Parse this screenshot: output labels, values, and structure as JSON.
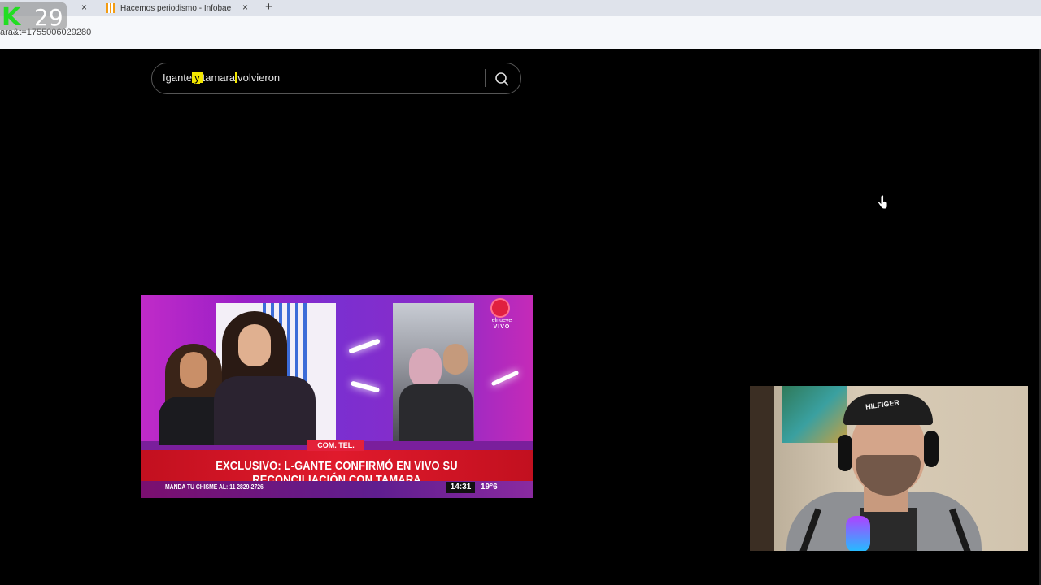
{
  "browser": {
    "tabs": [
      {
        "label": "",
        "close": "×"
      },
      {
        "label": "Hacemos periodismo - Infobae",
        "close": "×"
      }
    ],
    "new_tab": "+",
    "address": "ara&t=1755006029280",
    "overlay_badge": {
      "letter": "K",
      "number": "29",
      "color": "#22dd22"
    }
  },
  "search": {
    "query_parts": [
      "Igante",
      "y",
      "tamara",
      "volvieron"
    ],
    "icon": "search-icon"
  },
  "video": {
    "tag": "COM. TEL.",
    "headline": "EXCLUSIVO: L-GANTE CONFIRMÓ EN VIVO SU RECONCILIACIÓN CON TAMARA",
    "bottom_text": "MANDA TU CHISME AL: 11 2829-2726",
    "time": "14:31",
    "temperature": "19°6",
    "channel": "elnueve",
    "channel_live": "VIVO",
    "accent": "#e3213a"
  },
  "webcam": {
    "cap_text": "HILFIGER"
  },
  "colors": {
    "background": "#000000",
    "highlight": "#f2e600"
  }
}
